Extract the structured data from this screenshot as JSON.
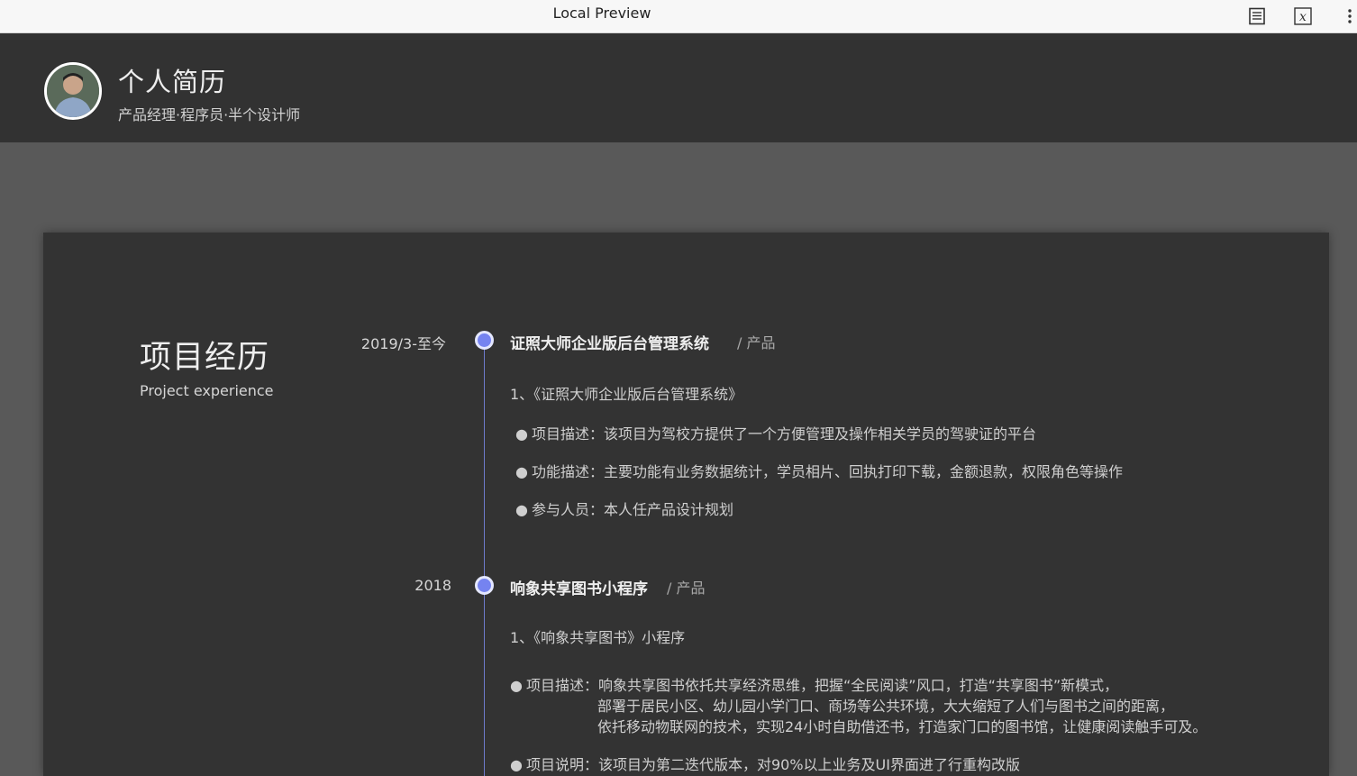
{
  "window": {
    "title": "Local Preview"
  },
  "toolbar": {
    "icons": [
      "document-icon",
      "formula-icon",
      "more-vertical-icon"
    ]
  },
  "header": {
    "name": "个人简历",
    "tagline": "产品经理·程序员·半个设计师"
  },
  "section": {
    "title": "项目经历",
    "subtitle": "Project experience"
  },
  "projects": [
    {
      "date": "2019/3-至今",
      "name": "证照大师企业版后台管理系统",
      "role": "/ 产品",
      "heading": "1、《证照大师企业版后台管理系统》",
      "items": [
        "项目描述：该项目为驾校方提供了一个方便管理及操作相关学员的驾驶证的平台",
        "功能描述：主要功能有业务数据统计，学员相片、回执打印下载，金额退款，权限角色等操作",
        "参与人员：本人任产品设计规划"
      ]
    },
    {
      "date": "2018",
      "name": "响象共享图书小程序",
      "role": "/ 产品",
      "heading": "1、《响象共享图书》小程序",
      "desc_label": "项目描述：",
      "desc_lines": [
        "响象共享图书依托共享经济思维，把握“全民阅读”风口，打造“共享图书”新模式，",
        "部署于居民小区、幼儿园小学门口、商场等公共环境，大大缩短了人们与图书之间的距离，",
        "依托移动物联网的技术，实现24小时自助借还书，打造家门口的图书馆，让健康阅读触手可及。"
      ],
      "note": "项目说明：该项目为第二迭代版本，对90%以上业务及UI界面进了行重构改版"
    }
  ],
  "colors": {
    "timeline_dot": "#7583f0",
    "header_bg": "#323232",
    "card_bg": "#333333",
    "page_bg": "#595959"
  }
}
